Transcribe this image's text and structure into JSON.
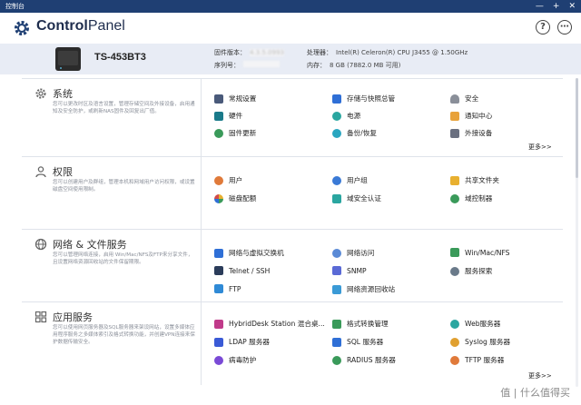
{
  "window": {
    "title": "控制台",
    "min": "—",
    "max": "+",
    "close": "✕"
  },
  "header": {
    "title_bold": "Control",
    "title_rest": "Panel",
    "help_icon": "help-icon",
    "settings_icon": "more-icon"
  },
  "device": {
    "model": "TS-453BT3",
    "firmware_label": "固件版本：",
    "firmware_value": "4.3.5.0993",
    "serial_label": "序列号：",
    "cpu_label": "处理器：",
    "cpu_value": "Intel(R) Celeron(R) CPU J3455 @ 1.50GHz",
    "memory_label": "内存：",
    "memory_value": "8 GB (7882.0 MB 可用)"
  },
  "sections": [
    {
      "title": "系统",
      "desc": "您可以更改时区及语言设置，管理存储空间及外接设备，启用通知及安全防护，或刷新NAS固件及回复出厂值。",
      "items": [
        "常规设置",
        "存储与快照总管",
        "安全",
        "硬件",
        "电源",
        "通知中心",
        "固件更新",
        "备份/恢复",
        "外接设备"
      ],
      "more": "更多>>"
    },
    {
      "title": "权限",
      "desc": "您可以创建用户及群组，管理本机和网域用户访问权限，或设置磁盘空间使用限制。",
      "items": [
        "用户",
        "用户组",
        "共享文件夹",
        "磁盘配额",
        "域安全认证",
        "域控制器"
      ]
    },
    {
      "title": "网络 & 文件服务",
      "desc": "您可以管理网络连接，启用 Win/Mac/NFS及FTP来分享文件，且设置网络资源回收站的文件保留期限。",
      "items": [
        "网络与虚拟交换机",
        "网络访问",
        "Win/Mac/NFS",
        "Telnet / SSH",
        "SNMP",
        "服务探索",
        "FTP",
        "网络资源回收站"
      ]
    },
    {
      "title": "应用服务",
      "desc": "您可以使用网页服务器及SQL服务器来架设网站，设置多媒体应用程序服务之多媒体索引及格式转换功能，并创建VPN连接来保护数据传输安全。",
      "items": [
        "HybridDesk Station 混合桌...",
        "格式转换管理",
        "Web服务器",
        "LDAP 服务器",
        "SQL 服务器",
        "Syslog 服务器",
        "病毒防护",
        "RADIUS 服务器",
        "TFTP 服务器"
      ],
      "more": "更多>>"
    }
  ],
  "watermark": "值 | 什么值得买",
  "colors": {
    "titlebar": "#1f3f73",
    "device_band": "#e8ecf5",
    "accent": "#2f6fd6"
  }
}
